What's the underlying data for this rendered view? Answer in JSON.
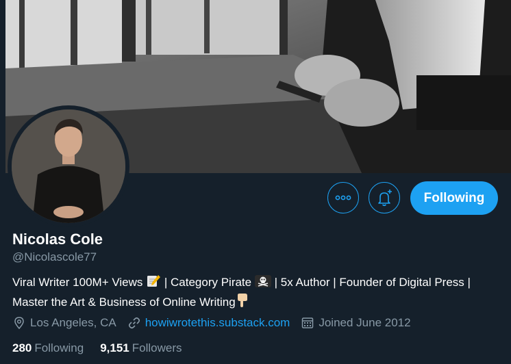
{
  "profile": {
    "name": "Nicolas Cole",
    "handle": "@Nicolascole77",
    "bio_part1": "Viral Writer 100M+ Views",
    "bio_part2": "| Category Pirate",
    "bio_part3": "| 5x Author | Founder of Digital Press | Master the Art & Business of Online Writing",
    "location": "Los Angeles, CA",
    "website": "howiwrotethis.substack.com",
    "joined": "Joined June 2012"
  },
  "actions": {
    "follow_label": "Following"
  },
  "stats": {
    "following_count": "280",
    "following_label": "Following",
    "followers_count": "9,151",
    "followers_label": "Followers"
  },
  "icons": {
    "more": "more-horizontal-icon",
    "notify": "bell-plus-icon",
    "location": "location-pin-icon",
    "link": "link-icon",
    "calendar": "calendar-icon",
    "memo": "memo-emoji-icon",
    "pirate": "skull-crossbones-emoji-icon",
    "pointing": "pointing-down-emoji-icon"
  },
  "colors": {
    "background": "#15202b",
    "accent": "#1da1f2",
    "secondary_text": "#8899a6"
  }
}
